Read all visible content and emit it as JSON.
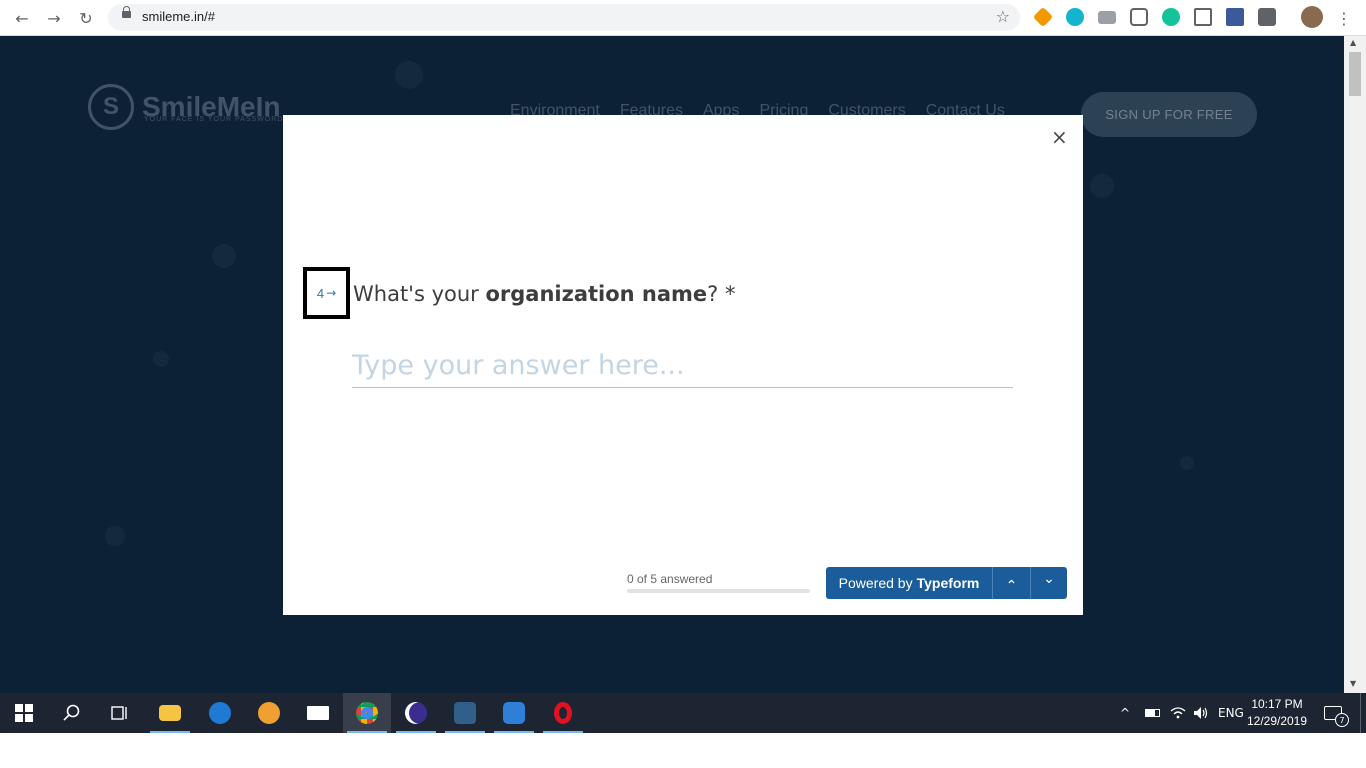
{
  "browser": {
    "url": "smileme.in/#",
    "back_icon": "←",
    "forward_icon": "→",
    "reload_icon": "↻",
    "star_icon": "☆",
    "menu_icon": "⋮"
  },
  "site": {
    "logo_letter": "S",
    "logo_text": "SmileMeIn",
    "logo_tagline": "YOUR FACE IS YOUR PASSWORD",
    "nav": [
      "Environment",
      "Features",
      "Apps",
      "Pricing",
      "Customers",
      "Contact Us"
    ],
    "signup_label": "SIGN UP FOR FREE"
  },
  "modal": {
    "close_icon": "×",
    "question_number": "4",
    "question_arrow": "→",
    "question_prefix": "What's your ",
    "question_bold": "organization name",
    "question_suffix": "? *",
    "answer_placeholder": "Type your answer here...",
    "answer_value": "",
    "progress_text": "0 of 5 answered",
    "progress_fraction": 0,
    "powered_by": "Powered by",
    "brand": "Typeform",
    "up_icon": "⌃",
    "down_icon": "⌄"
  },
  "taskbar": {
    "language": "ENG",
    "time": "10:17 PM",
    "date": "12/29/2019",
    "notification_count": "7",
    "tray_up_icon": "^"
  },
  "colors": {
    "page_bg": "#0c2136",
    "typeform_blue": "#1a5d9a",
    "accent_blue": "#2e78b0"
  }
}
